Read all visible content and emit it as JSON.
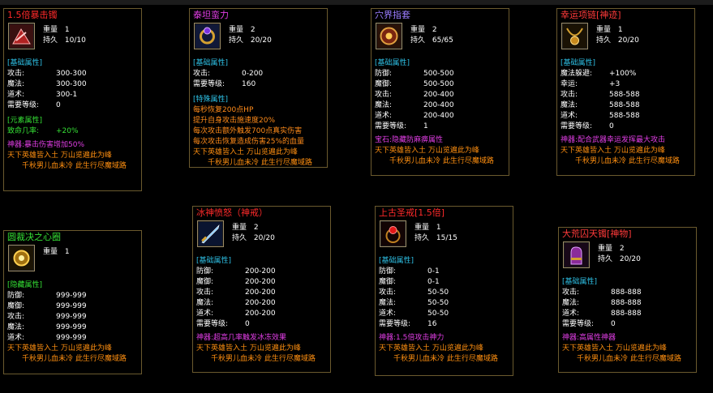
{
  "labels": {
    "weight": "重量",
    "durability": "持久",
    "lore": "天下英雄皆入土 万山览遍此为峰",
    "lore2": "千秋男儿血未冷 此生行尽魔域路"
  },
  "colors": {
    "card_border": "#6b5a2e",
    "section_heading": "#2ec1e6",
    "special_text": "#ff8b1a",
    "lore_text": "#ff8f10",
    "title_red": "#ff2a2a",
    "title_magenta": "#e23ee6",
    "title_green": "#35e035",
    "title_purple": "#c084ff"
  },
  "items": [
    {
      "name": "1.5倍暴击镯",
      "title_color": "#ff2a2a",
      "icon": "bracelet-icon",
      "weight": "1",
      "durability": "10/10",
      "sections": [
        {
          "heading": "[基础属性]",
          "rows": [
            {
              "label": "攻击:",
              "value": "300-300"
            },
            {
              "label": "魔法:",
              "value": "300-300"
            },
            {
              "label": "道术:",
              "value": "300-1"
            },
            {
              "label": "需要等级:",
              "value": "0"
            }
          ]
        },
        {
          "heading": "[元素属性]",
          "style": "element",
          "rows": [
            {
              "label": "致命几率:",
              "value": "+20%"
            }
          ]
        }
      ],
      "god_text": "神器:暴击伤害增加50%"
    },
    {
      "name": "泰坦蛮力",
      "title_color": "#e23ee6",
      "icon": "ring-icon",
      "weight": "2",
      "durability": "20/20",
      "sections": [
        {
          "heading": "[基础属性]",
          "rows": [
            {
              "label": "攻击:",
              "value": "0-200"
            },
            {
              "label": "需要等级:",
              "value": "160"
            }
          ]
        },
        {
          "heading": "[特殊属性]",
          "special": [
            "每秒恢复200点HP",
            "提升自身攻击施速度20%",
            "每次攻击额外触发700点真实伤害",
            "每次攻击恢复造成伤害25%的血量"
          ]
        }
      ],
      "god_text": ""
    },
    {
      "name": "穴界指套",
      "title_color": "#9b7dff",
      "icon": "medallion-icon",
      "weight": "2",
      "durability": "65/65",
      "sections": [
        {
          "heading": "[基础属性]",
          "rows": [
            {
              "label": "防御:",
              "value": "500-500"
            },
            {
              "label": "魔御:",
              "value": "500-500"
            },
            {
              "label": "攻击:",
              "value": "200-400"
            },
            {
              "label": "魔法:",
              "value": "200-400"
            },
            {
              "label": "道术:",
              "value": "200-400"
            },
            {
              "label": "需要等级:",
              "value": "1"
            }
          ]
        }
      ],
      "god_text": "宝石:隐藏防麻痹属性"
    },
    {
      "name": "幸运项链[神迹]",
      "title_color": "#ff3a3a",
      "icon": "necklace-icon",
      "weight": "1",
      "durability": "20/20",
      "sections": [
        {
          "heading": "[基础属性]",
          "rows": [
            {
              "label": "魔法躲避:",
              "value": "+100%"
            },
            {
              "label": "幸运:",
              "value": "+3"
            },
            {
              "label": "攻击:",
              "value": "588-588"
            },
            {
              "label": "魔法:",
              "value": "588-588"
            },
            {
              "label": "道术:",
              "value": "588-588"
            },
            {
              "label": "需要等级:",
              "value": "0"
            }
          ]
        }
      ],
      "god_text": "神器:配合武器幸运发挥最大攻击"
    },
    {
      "name": "圆裁决之心圈",
      "title_color": "#35e035",
      "icon": "sun-amulet-icon",
      "weight": "1",
      "durability": "",
      "sections": [
        {
          "heading": "[隐藏属性]",
          "rows": [
            {
              "label": "防御:",
              "value": "999-999"
            },
            {
              "label": "魔御:",
              "value": "999-999"
            },
            {
              "label": "攻击:",
              "value": "999-999"
            },
            {
              "label": "魔法:",
              "value": "999-999"
            },
            {
              "label": "道术:",
              "value": "999-999"
            }
          ]
        }
      ],
      "god_text": ""
    },
    {
      "name": "冰神愤怒（神戒）",
      "title_color": "#ff2a2a",
      "icon": "sword-icon",
      "weight": "2",
      "durability": "20/20",
      "sections": [
        {
          "heading": "[基础属性]",
          "rows": [
            {
              "label": "防御:",
              "value": "200-200"
            },
            {
              "label": "魔御:",
              "value": "200-200"
            },
            {
              "label": "攻击:",
              "value": "200-200"
            },
            {
              "label": "魔法:",
              "value": "200-200"
            },
            {
              "label": "道术:",
              "value": "200-200"
            },
            {
              "label": "需要等级:",
              "value": "0"
            }
          ]
        }
      ],
      "god_text": "神器:超高几率触发冰冻效果"
    },
    {
      "name": "上古圣戒[1.5倍]",
      "title_color": "#ff2a2a",
      "icon": "ruby-ring-icon",
      "weight": "1",
      "durability": "15/15",
      "sections": [
        {
          "heading": "[基础属性]",
          "rows": [
            {
              "label": "防御:",
              "value": "0-1"
            },
            {
              "label": "魔御:",
              "value": "0-1"
            },
            {
              "label": "攻击:",
              "value": "50-50"
            },
            {
              "label": "魔法:",
              "value": "50-50"
            },
            {
              "label": "道术:",
              "value": "50-50"
            },
            {
              "label": "需要等级:",
              "value": "16"
            }
          ]
        }
      ],
      "god_text": "神器:1.5倍攻击神力"
    },
    {
      "name": "大荒囚天镯[神物]",
      "title_color": "#ff3a3a",
      "icon": "gauntlet-icon",
      "weight": "2",
      "durability": "20/20",
      "sections": [
        {
          "heading": "[基础属性]",
          "rows": [
            {
              "label": "攻击:",
              "value": "888-888"
            },
            {
              "label": "魔法:",
              "value": "888-888"
            },
            {
              "label": "道术:",
              "value": "888-888"
            },
            {
              "label": "需要等级:",
              "value": "0"
            }
          ]
        }
      ],
      "god_text": "神器:高属性神器"
    }
  ]
}
